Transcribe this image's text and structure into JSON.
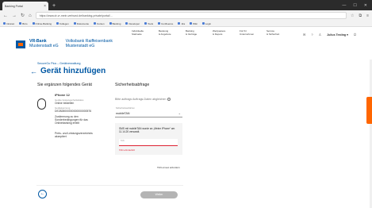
{
  "browser": {
    "tab_title": "Banking Portal",
    "url_main": "https://www.dr-vr-mein-verbund.de/banking-private/portal/...",
    "bookmarks": [
      "Intranet",
      "Büro",
      "Online-Banking",
      "Kollegen",
      "Dokumente",
      "Konten",
      "Banking",
      "Developer",
      "Tools",
      "Confluence",
      "Jira",
      "Wiki",
      "Login"
    ]
  },
  "bank": {
    "name_line1": "VR-Bank",
    "name_line2": "Mustenstadt eG",
    "name_line3": "Volksbank Raiffeisenbank",
    "name_line4": "Mustenstadt eG"
  },
  "nav": [
    {
      "l1": "Individuelle",
      "l2": "Startseite"
    },
    {
      "l1": "Beratung",
      "l2": "& Angebote"
    },
    {
      "l1": "Banking",
      "l2": "& Verträge"
    },
    {
      "l1": "Wertpapiere",
      "l2": "& Depots"
    },
    {
      "l1": "Für Ihr",
      "l2": "Unternehmen"
    },
    {
      "l1": "Service",
      "l2": "& Sicherheit"
    }
  ],
  "header_right": {
    "user": "Julius Testing ▾"
  },
  "page": {
    "breadcrumb": "SecureGo Plus – Gerätverwaltung",
    "title": "Gerät hinzufügen",
    "left_heading": "Sie ergänzen folgendes Gerät",
    "right_heading": "Sicherheitsabfrage"
  },
  "device": {
    "name": "iPhone 12",
    "status_label": "Geräte-Vergangenheitsstatus",
    "status": "Online bestellen",
    "id_label": "Gerätekennung",
    "id": "DE2828000000000000000576",
    "consent": "Zustimmung zu den Sonderbedingungen für das Onlinebanking erteilt",
    "price": "Preis- und Leistungsverzeichnis akzeptiert"
  },
  "auth": {
    "info": "Bitte auftrags Auftrags-Daten abgleichen",
    "select_label": "Sicherheitsverfahren",
    "select_value": "mobileTAN",
    "sms_msg": "SMS mit mobileTAN wurde an „Meine iPhone“ am 11.14.20 versandt.",
    "tan_label": "TAN",
    "tan_error": "TAN erforderlich",
    "resend": "TAN erneut anfordern"
  },
  "actions": {
    "weiter": "Weiter"
  },
  "colors": {
    "brand": "#0058a4",
    "accent": "#ff6600"
  }
}
